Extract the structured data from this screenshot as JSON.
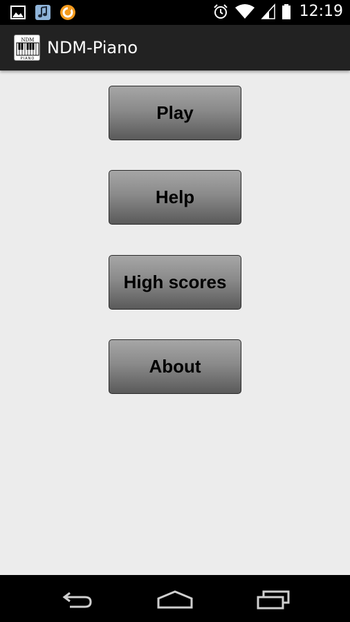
{
  "status_bar": {
    "time": "12:19",
    "notifications": [
      "image-icon",
      "music-icon",
      "sync-icon"
    ],
    "system_icons": [
      "alarm-icon",
      "wifi-icon",
      "signal-icon",
      "battery-icon"
    ]
  },
  "action_bar": {
    "title": "NDM-Piano",
    "icon": "piano-app-icon",
    "icon_text_top": "NDM",
    "icon_text_bottom": "PIANO"
  },
  "menu": {
    "play": "Play",
    "help": "Help",
    "high_scores": "High scores",
    "about": "About"
  },
  "nav_bar": {
    "buttons": [
      "back-icon",
      "home-icon",
      "recent-apps-icon"
    ]
  },
  "colors": {
    "background": "#ececec",
    "action_bar": "#222222",
    "status_bar": "#000000",
    "button_top": "#a6a6a6",
    "button_bottom": "#5a5a5a",
    "music_icon_bg": "#8fb4d9",
    "sync_icon": "#f39a1d"
  }
}
